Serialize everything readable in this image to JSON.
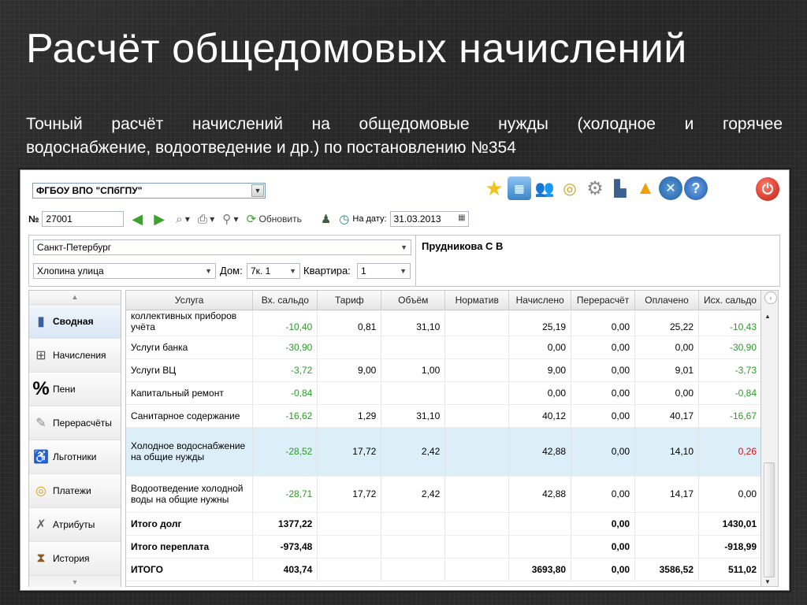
{
  "slide": {
    "title": "Расчёт общедомовых начислений",
    "desc_line1": "Точный расчёт начислений на общедомовые нужды (холодное и горячее",
    "desc_line2": "водоснабжение, водоотведение и др.) по постановлению №354"
  },
  "app": {
    "org": "ФГБОУ ВПО \"СПбГПУ\"",
    "top_icons": [
      "star-icon",
      "building-icon",
      "users-icon",
      "coins-icon",
      "gears-icon",
      "factory-icon",
      "warning-icon",
      "tools-icon",
      "help-icon"
    ],
    "toolbar": {
      "num_label": "№",
      "num_value": "27001",
      "refresh_label": "Обновить",
      "date_label": "На дату:",
      "date_value": "31.03.2013"
    },
    "address": {
      "city": "Санкт-Петербург",
      "street": "Хлопина улица",
      "house_label": "Дом:",
      "house_value": "7к. 1",
      "flat_label": "Квартира:",
      "flat_value": "1",
      "owner": "Прудникова С В"
    },
    "sidebar": [
      {
        "label": "Сводная",
        "icon": "book-icon",
        "active": true
      },
      {
        "label": "Начисления",
        "icon": "calculator-person-icon",
        "active": false
      },
      {
        "label": "Пени",
        "icon": "percent-icon",
        "active": false
      },
      {
        "label": "Перерасчёты",
        "icon": "recalc-icon",
        "active": false
      },
      {
        "label": "Льготники",
        "icon": "wheelchair-icon",
        "active": false
      },
      {
        "label": "Платежи",
        "icon": "coins-icon",
        "active": false
      },
      {
        "label": "Атрибуты",
        "icon": "tools-icon",
        "active": false
      },
      {
        "label": "История",
        "icon": "hourglass-icon",
        "active": false
      }
    ],
    "table": {
      "columns": [
        "Услуга",
        "Вх. сальдо",
        "Тариф",
        "Объём",
        "Норматив",
        "Начислено",
        "Перерасчёт",
        "Оплачено",
        "Исх. сальдо"
      ],
      "cut_row": [
        "коллективных приборов учёта",
        "-10,40",
        "0,81",
        "31,10",
        "",
        "25,19",
        "0,00",
        "25,22",
        "-10,43"
      ],
      "rows": [
        [
          "Услуги банка",
          "-30,90",
          "",
          "",
          "",
          "0,00",
          "0,00",
          "0,00",
          "-30,90"
        ],
        [
          "Услуги ВЦ",
          "-3,72",
          "9,00",
          "1,00",
          "",
          "9,00",
          "0,00",
          "9,01",
          "-3,73"
        ],
        [
          "Капитальный ремонт",
          "-0,84",
          "",
          "",
          "",
          "0,00",
          "0,00",
          "0,00",
          "-0,84"
        ],
        [
          "Санитарное содержание",
          "-16,62",
          "1,29",
          "31,10",
          "",
          "40,12",
          "0,00",
          "40,17",
          "-16,67"
        ],
        [
          "Холодное водоснабжение на общие нужды",
          "-28,52",
          "17,72",
          "2,42",
          "",
          "42,88",
          "0,00",
          "14,10",
          "0,26"
        ],
        [
          "Водоотведение холодной воды на общие нужны",
          "-28,71",
          "17,72",
          "2,42",
          "",
          "42,88",
          "0,00",
          "14,17",
          "0,00"
        ],
        [
          "Итого долг",
          "1377,22",
          "",
          "",
          "",
          "",
          "0,00",
          "",
          "1430,01"
        ],
        [
          "Итого переплата",
          "-973,48",
          "",
          "",
          "",
          "",
          "0,00",
          "",
          "-918,99"
        ],
        [
          "ИТОГО",
          "403,74",
          "",
          "",
          "",
          "3693,80",
          "0,00",
          "3586,52",
          "511,02"
        ]
      ]
    }
  }
}
